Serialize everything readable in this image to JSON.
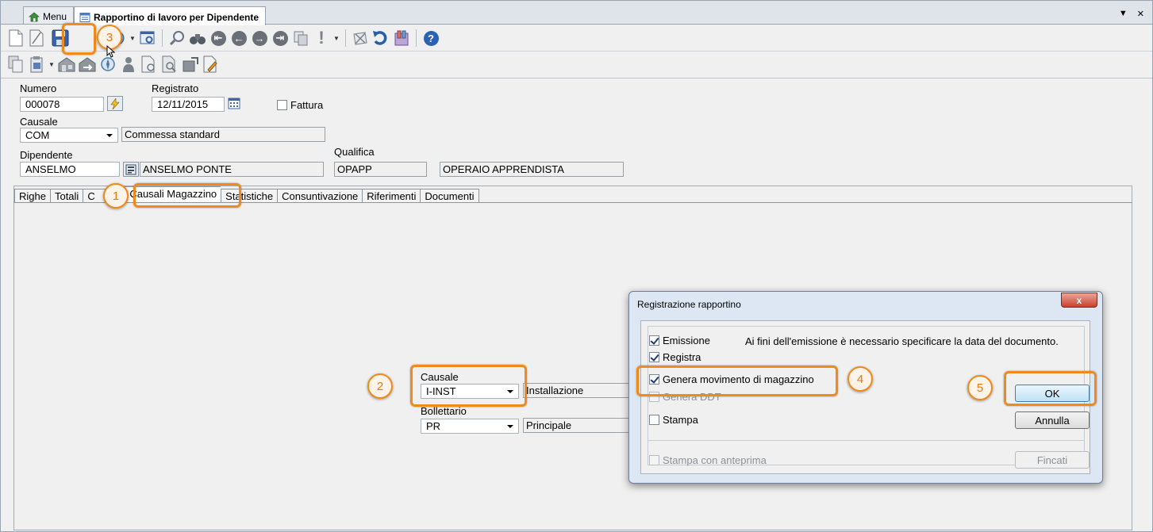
{
  "doc_tabs": [
    {
      "label": "Menu",
      "active": false
    },
    {
      "label": "Rapportino di lavoro per Dipendente",
      "active": true
    }
  ],
  "form": {
    "numero_label": "Numero",
    "numero_value": "000078",
    "registrato_label": "Registrato",
    "registrato_value": "12/11/2015",
    "fattura_label": "Fattura",
    "causale_label": "Causale",
    "causale_code": "COM",
    "causale_desc": "Commessa standard",
    "dipendente_label": "Dipendente",
    "dipendente_code": "ANSELMO",
    "dipendente_desc": "ANSELMO PONTE",
    "qualifica_label": "Qualifica",
    "qualifica_code": "OPAPP",
    "qualifica_desc": "OPERAIO APPRENDISTA"
  },
  "tabs": [
    {
      "label": "Righe",
      "active": false
    },
    {
      "label": "Totali",
      "active": false
    },
    {
      "label": "Causali Magazzino",
      "active": true
    },
    {
      "label": "Statistiche",
      "active": false
    },
    {
      "label": "Consuntivazione",
      "active": false
    },
    {
      "label": "Riferimenti",
      "active": false
    },
    {
      "label": "Documenti",
      "active": false
    }
  ],
  "tab_partial_text": "C",
  "tab_partial_text_2": "li",
  "magazzino": {
    "causale_label": "Causale",
    "causale_code": "I-INST",
    "causale_desc": "Installazione",
    "bollettario_label": "Bollettario",
    "bollettario_code": "PR",
    "bollettario_desc": "Principale"
  },
  "dialog": {
    "title": "Registrazione rapportino",
    "close_symbol": "x",
    "message": "Ai fini dell'emissione è necessario specificare la data del documento.",
    "checks": [
      {
        "label": "Emissione",
        "checked": true,
        "enabled": true
      },
      {
        "label": "Registra",
        "checked": true,
        "enabled": true
      },
      {
        "label": "Genera movimento di magazzino",
        "checked": true,
        "enabled": true
      },
      {
        "label": "Genera DDT",
        "checked": false,
        "enabled": false
      },
      {
        "label": "Stampa",
        "checked": false,
        "enabled": true
      },
      {
        "label": "Stampa con anteprima",
        "checked": false,
        "enabled": false
      }
    ],
    "ok_label": "OK",
    "cancel_label": "Annulla",
    "fincati_label": "Fincati"
  },
  "badges": [
    "1",
    "2",
    "3",
    "4",
    "5"
  ],
  "colors": {
    "highlight": "#f08a1c",
    "accent": "#1f4f9a"
  }
}
